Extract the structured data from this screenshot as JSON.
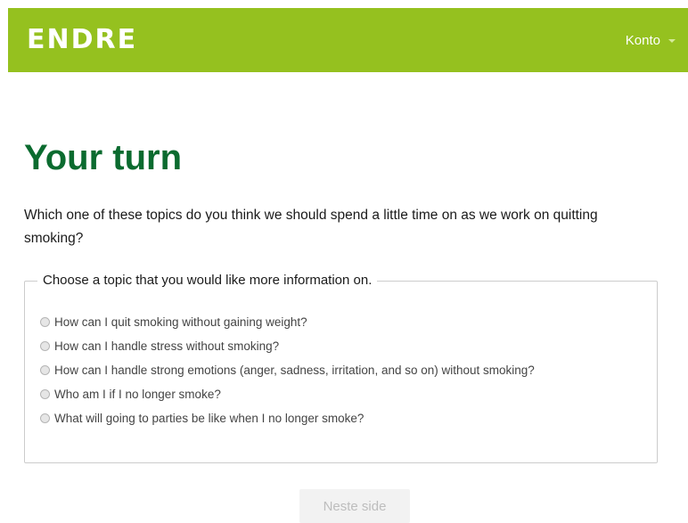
{
  "header": {
    "logo_text": "ENDRE",
    "account_label": "Konto",
    "brand_color": "#95c11f"
  },
  "main": {
    "title": "Your turn",
    "title_color": "#0b6b2f",
    "intro": "Which one of these topics do you think we should spend a little time on as we work on quitting smoking?",
    "fieldset_legend": "Choose a topic that you would like more information on.",
    "options": [
      {
        "label": "How can I quit smoking without gaining weight?",
        "selected": false
      },
      {
        "label": "How can I handle stress without smoking?",
        "selected": false
      },
      {
        "label": "How can I handle strong emotions (anger, sadness, irritation, and so on) without smoking?",
        "selected": false
      },
      {
        "label": "Who am I if I no longer smoke?",
        "selected": false
      },
      {
        "label": "What will going to parties be like when I no longer smoke?",
        "selected": false
      }
    ],
    "next_button_label": "Neste side",
    "next_button_enabled": false
  }
}
